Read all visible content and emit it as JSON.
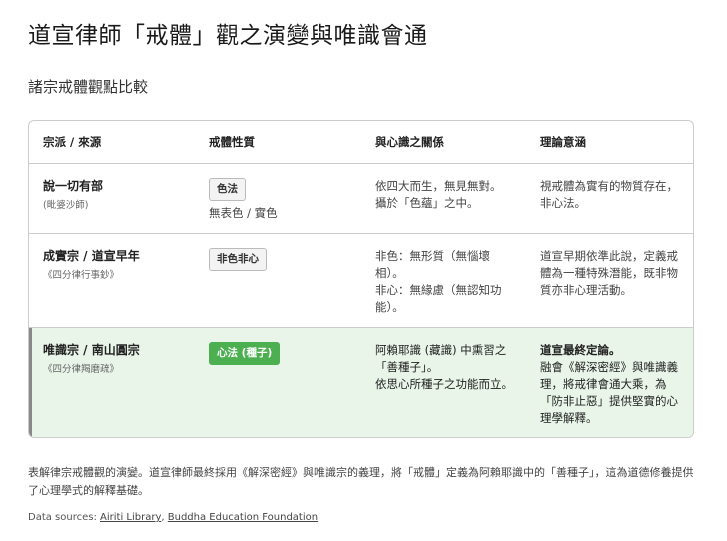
{
  "title": "道宣律師「戒體」觀之演變與唯識會通",
  "subtitle": "諸宗戒體觀點比較",
  "table": {
    "headers": [
      "宗派 / 來源",
      "戒體性質",
      "與心識之關係",
      "理論意涵"
    ],
    "rows": [
      {
        "name": "說一切有部",
        "source": "(毗婆沙師)",
        "badge": "色法",
        "nature_note": "無表色 / 實色",
        "relation": [
          "依四大而生，無見無對。",
          "攝於「色蘊」之中。"
        ],
        "implication_bold": "",
        "implication": "視戒體為實有的物質存在，非心法。"
      },
      {
        "name": "成實宗 / 道宣早年",
        "source": "《四分律行事鈔》",
        "badge": "非色非心",
        "nature_note": "",
        "relation": [
          "非色：無形質（無惱壞相）。",
          "非心：無緣慮（無認知功能）。"
        ],
        "implication_bold": "",
        "implication": "道宣早期依準此說，定義戒體為一種特殊潛能，既非物質亦非心理活動。"
      },
      {
        "name": "唯識宗 / 南山圓宗",
        "source": "《四分律羯磨疏》",
        "badge": "心法 (種子)",
        "nature_note": "",
        "relation": [
          "阿賴耶識 (藏識) 中熏習之「善種子」。",
          "依思心所種子之功能而立。"
        ],
        "implication_bold": "道宣最終定論。",
        "implication": "融會《解深密經》與唯識義理，將戒律會通大乘，為「防非止惡」提供堅實的心理學解釋。"
      }
    ]
  },
  "caption": "表解律宗戒體觀的演變。道宣律師最終採用《解深密經》與唯識宗的義理，將「戒體」定義為阿賴耶識中的「善種子」，這為道德修養提供了心理學式的解釋基礎。",
  "sources": {
    "label": "Data sources:",
    "links": [
      "Airiti Library",
      "Buddha Education Foundation"
    ]
  },
  "colors": {
    "highlight_bg": "#e9f5e9",
    "badge_green": "#4caf50"
  }
}
